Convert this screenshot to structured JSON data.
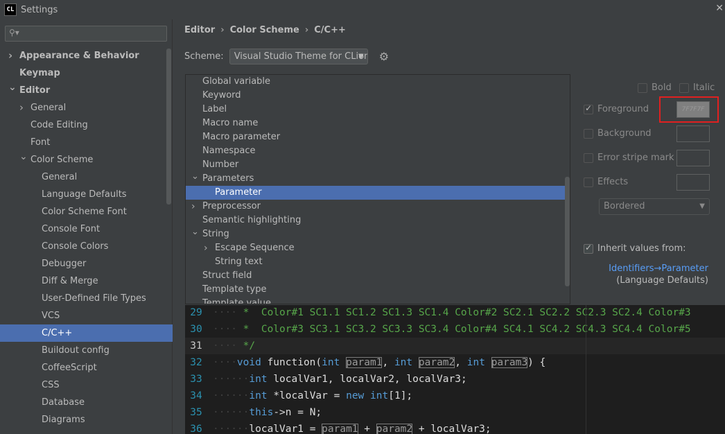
{
  "window": {
    "title": "Settings",
    "icon_text": "CL",
    "close": "✕"
  },
  "sidebar": {
    "search_placeholder": "",
    "items": [
      {
        "label": "Appearance & Behavior",
        "level": 0,
        "bold": true,
        "arrow": "right"
      },
      {
        "label": "Keymap",
        "level": 0,
        "bold": true,
        "arrow": ""
      },
      {
        "label": "Editor",
        "level": 0,
        "bold": true,
        "arrow": "down"
      },
      {
        "label": "General",
        "level": 1,
        "bold": false,
        "arrow": "right"
      },
      {
        "label": "Code Editing",
        "level": 1,
        "bold": false,
        "arrow": ""
      },
      {
        "label": "Font",
        "level": 1,
        "bold": false,
        "arrow": ""
      },
      {
        "label": "Color Scheme",
        "level": 1,
        "bold": false,
        "arrow": "down"
      },
      {
        "label": "General",
        "level": 2,
        "bold": false,
        "arrow": ""
      },
      {
        "label": "Language Defaults",
        "level": 2,
        "bold": false,
        "arrow": ""
      },
      {
        "label": "Color Scheme Font",
        "level": 2,
        "bold": false,
        "arrow": ""
      },
      {
        "label": "Console Font",
        "level": 2,
        "bold": false,
        "arrow": ""
      },
      {
        "label": "Console Colors",
        "level": 2,
        "bold": false,
        "arrow": ""
      },
      {
        "label": "Debugger",
        "level": 2,
        "bold": false,
        "arrow": ""
      },
      {
        "label": "Diff & Merge",
        "level": 2,
        "bold": false,
        "arrow": ""
      },
      {
        "label": "User-Defined File Types",
        "level": 2,
        "bold": false,
        "arrow": ""
      },
      {
        "label": "VCS",
        "level": 2,
        "bold": false,
        "arrow": ""
      },
      {
        "label": "C/C++",
        "level": 2,
        "bold": false,
        "arrow": "",
        "selected": true
      },
      {
        "label": "Buildout config",
        "level": 2,
        "bold": false,
        "arrow": ""
      },
      {
        "label": "CoffeeScript",
        "level": 2,
        "bold": false,
        "arrow": ""
      },
      {
        "label": "CSS",
        "level": 2,
        "bold": false,
        "arrow": ""
      },
      {
        "label": "Database",
        "level": 2,
        "bold": false,
        "arrow": ""
      },
      {
        "label": "Diagrams",
        "level": 2,
        "bold": false,
        "arrow": ""
      }
    ]
  },
  "breadcrumb": [
    "Editor",
    "Color Scheme",
    "C/C++"
  ],
  "scheme": {
    "label": "Scheme:",
    "value": "Visual Studio Theme for CLion"
  },
  "attributes": [
    {
      "label": "Global variable",
      "level": 0,
      "arrow": ""
    },
    {
      "label": "Keyword",
      "level": 0,
      "arrow": ""
    },
    {
      "label": "Label",
      "level": 0,
      "arrow": ""
    },
    {
      "label": "Macro name",
      "level": 0,
      "arrow": ""
    },
    {
      "label": "Macro parameter",
      "level": 0,
      "arrow": ""
    },
    {
      "label": "Namespace",
      "level": 0,
      "arrow": ""
    },
    {
      "label": "Number",
      "level": 0,
      "arrow": ""
    },
    {
      "label": "Parameters",
      "level": 0,
      "arrow": "down"
    },
    {
      "label": "Parameter",
      "level": 1,
      "arrow": "",
      "selected": true
    },
    {
      "label": "Preprocessor",
      "level": 0,
      "arrow": "right"
    },
    {
      "label": "Semantic highlighting",
      "level": 0,
      "arrow": ""
    },
    {
      "label": "String",
      "level": 0,
      "arrow": "down"
    },
    {
      "label": "Escape Sequence",
      "level": 1,
      "arrow": "right"
    },
    {
      "label": "String text",
      "level": 1,
      "arrow": ""
    },
    {
      "label": "Struct field",
      "level": 0,
      "arrow": ""
    },
    {
      "label": "Template type",
      "level": 0,
      "arrow": ""
    },
    {
      "label": "Template value",
      "level": 0,
      "arrow": ""
    }
  ],
  "properties": {
    "bold": "Bold",
    "italic": "Italic",
    "foreground": "Foreground",
    "foreground_value": "7F7F7F",
    "background": "Background",
    "error_stripe": "Error stripe mark",
    "effects": "Effects",
    "effects_type": "Bordered",
    "inherit": "Inherit values from:",
    "inherit_link": "Identifiers→Parameter",
    "inherit_sub": "(Language Defaults)"
  },
  "editor": {
    "lines": [
      {
        "n": "29",
        "segs": [
          [
            "dot",
            "····"
          ],
          [
            "cm",
            " *  Color#1 SC1.1 SC1.2 SC1.3 SC1.4 Color#2 SC2.1 SC2.2 SC2.3 SC2.4 Color#3"
          ]
        ]
      },
      {
        "n": "30",
        "segs": [
          [
            "dot",
            "····"
          ],
          [
            "cm",
            " *  Color#3 SC3.1 SC3.2 SC3.3 SC3.4 Color#4 SC4.1 SC4.2 SC4.3 SC4.4 Color#5"
          ]
        ]
      },
      {
        "n": "31",
        "current": true,
        "segs": [
          [
            "dot",
            "····"
          ],
          [
            "cm",
            " */"
          ]
        ]
      },
      {
        "n": "32",
        "segs": [
          [
            "dot",
            "····"
          ],
          [
            "kw",
            "void"
          ],
          [
            "tx",
            " function("
          ],
          [
            "kw",
            "int"
          ],
          [
            "tx",
            " "
          ],
          [
            "pm",
            "param1"
          ],
          [
            "tx",
            ", "
          ],
          [
            "kw",
            "int"
          ],
          [
            "tx",
            " "
          ],
          [
            "pm",
            "param2"
          ],
          [
            "tx",
            ", "
          ],
          [
            "kw",
            "int"
          ],
          [
            "tx",
            " "
          ],
          [
            "pm",
            "param3"
          ],
          [
            "tx",
            ") {"
          ]
        ]
      },
      {
        "n": "33",
        "segs": [
          [
            "dot",
            "······"
          ],
          [
            "kw",
            "int"
          ],
          [
            "tx",
            " localVar1, localVar2, localVar3;"
          ]
        ]
      },
      {
        "n": "34",
        "segs": [
          [
            "dot",
            "······"
          ],
          [
            "kw",
            "int"
          ],
          [
            "tx",
            " *localVar = "
          ],
          [
            "kw",
            "new"
          ],
          [
            "tx",
            " "
          ],
          [
            "kw",
            "int"
          ],
          [
            "tx",
            "[1];"
          ]
        ]
      },
      {
        "n": "35",
        "segs": [
          [
            "dot",
            "······"
          ],
          [
            "kw",
            "this"
          ],
          [
            "tx",
            "->"
          ],
          [
            "mb",
            "n"
          ],
          [
            "tx",
            " = N;"
          ]
        ]
      },
      {
        "n": "36",
        "segs": [
          [
            "dot",
            "······"
          ],
          [
            "tx",
            "localVar1 = "
          ],
          [
            "pm",
            "param1"
          ],
          [
            "tx",
            " + "
          ],
          [
            "pm",
            "param2"
          ],
          [
            "tx",
            " + localVar3;"
          ]
        ]
      }
    ]
  }
}
